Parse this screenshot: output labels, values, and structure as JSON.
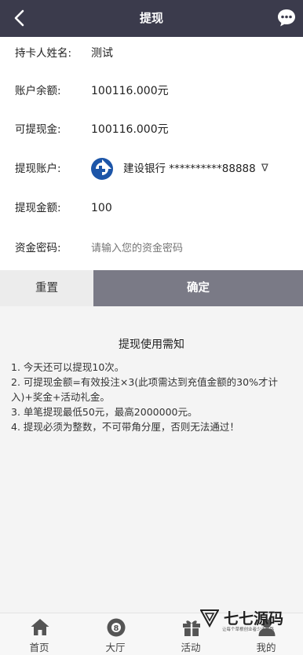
{
  "header": {
    "title": "提现"
  },
  "form": {
    "name_label": "持卡人姓名:",
    "name_value": "测试",
    "balance_label": "账户余额:",
    "balance_value": "100116.000元",
    "withdrawable_label": "可提现金:",
    "withdrawable_value": "100116.000元",
    "account_label": "提现账户:",
    "account_bank": "建设银行 **********88888",
    "account_arrow": "∇",
    "amount_label": "提现金额:",
    "amount_value": "100",
    "password_label": "资金密码:",
    "password_placeholder": "请输入您的资金密码"
  },
  "actions": {
    "reset": "重置",
    "confirm": "确定"
  },
  "notice": {
    "title": "提现使用需知",
    "lines": [
      "1. 今天还可以提现10次。",
      "2. 可提现金额=有效投注×3(此项需达到充值金额的30%才计入)+奖金+活动礼金。",
      "3. 单笔提现最低50元，最高2000000元。",
      "4. 提现必须为整数，不可带角分厘，否则无法通过！"
    ]
  },
  "tabbar": [
    {
      "label": "首页",
      "icon": "home-icon"
    },
    {
      "label": "大厅",
      "icon": "lottery-ball-icon"
    },
    {
      "label": "活动",
      "icon": "gift-icon"
    },
    {
      "label": "我的",
      "icon": "user-icon"
    }
  ],
  "watermark": {
    "text": "七七源码",
    "sub": "让每个草根创业者少走弯路"
  },
  "colors": {
    "header_bg": "#3b3b4c",
    "confirm_bg": "#7a7a86",
    "bank_blue": "#1c55a8"
  }
}
